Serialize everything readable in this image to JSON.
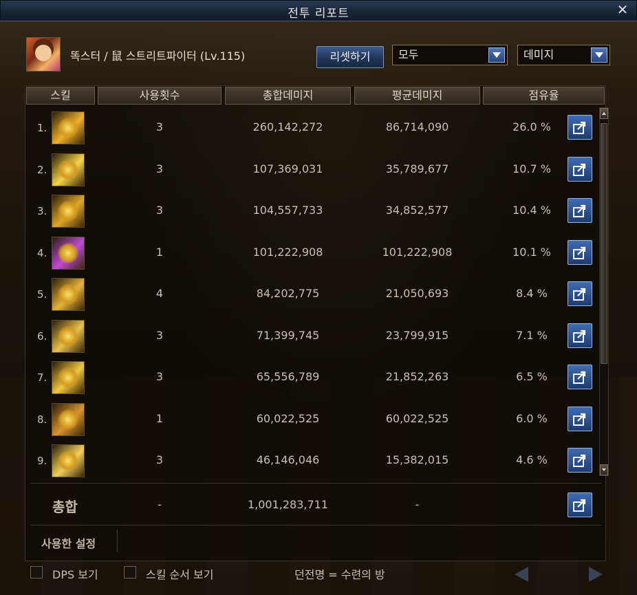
{
  "window": {
    "title": "전투 리포트",
    "close_icon": "close-icon"
  },
  "header": {
    "character": "똑스터 / 鼠 스트리트파이터 (Lv.115)",
    "reset_label": "리셋하기",
    "filter_value": "모두",
    "type_value": "데미지"
  },
  "columns": {
    "skill": "스킬",
    "uses": "사용횟수",
    "total": "총합데미지",
    "average": "평균데미지",
    "share": "점유율"
  },
  "rows": [
    {
      "index": "1.",
      "uses": "3",
      "total": "260,142,272",
      "average": "86,714,090",
      "share": "26.0 %",
      "icon": "skill-icon-1",
      "color": "#f0b02a"
    },
    {
      "index": "2.",
      "uses": "3",
      "total": "107,369,031",
      "average": "35,789,677",
      "share": "10.7 %",
      "icon": "skill-icon-2",
      "color": "#f3d548"
    },
    {
      "index": "3.",
      "uses": "3",
      "total": "104,557,733",
      "average": "34,852,577",
      "share": "10.4 %",
      "icon": "skill-icon-3",
      "color": "#e0a82a"
    },
    {
      "index": "4.",
      "uses": "1",
      "total": "101,222,908",
      "average": "101,222,908",
      "share": "10.1 %",
      "icon": "skill-icon-4",
      "color": "#c04ad8"
    },
    {
      "index": "5.",
      "uses": "4",
      "total": "84,202,775",
      "average": "21,050,693",
      "share": "8.4 %",
      "icon": "skill-icon-5",
      "color": "#e6b03a"
    },
    {
      "index": "6.",
      "uses": "3",
      "total": "71,399,745",
      "average": "23,799,915",
      "share": "7.1 %",
      "icon": "skill-icon-6",
      "color": "#e8c04a"
    },
    {
      "index": "7.",
      "uses": "3",
      "total": "65,556,789",
      "average": "21,852,263",
      "share": "6.5 %",
      "icon": "skill-icon-7",
      "color": "#f0c640"
    },
    {
      "index": "8.",
      "uses": "1",
      "total": "60,022,525",
      "average": "60,022,525",
      "share": "6.0 %",
      "icon": "skill-icon-8",
      "color": "#d9932c"
    },
    {
      "index": "9.",
      "uses": "3",
      "total": "46,146,046",
      "average": "15,382,015",
      "share": "4.6 %",
      "icon": "skill-icon-9",
      "color": "#f2cf5a"
    }
  ],
  "total": {
    "label": "총합",
    "uses": "-",
    "sum": "1,001,283,711",
    "average": "-"
  },
  "settings": {
    "label": "사용한 설정"
  },
  "footer": {
    "dps_label": "DPS 보기",
    "order_label": "스킬 순서 보기",
    "dungeon_text": "던전명 = 수련의 방"
  },
  "colors": {
    "accent": "#27457e",
    "panel": "#0f0c09",
    "text": "#c9c1ae"
  }
}
